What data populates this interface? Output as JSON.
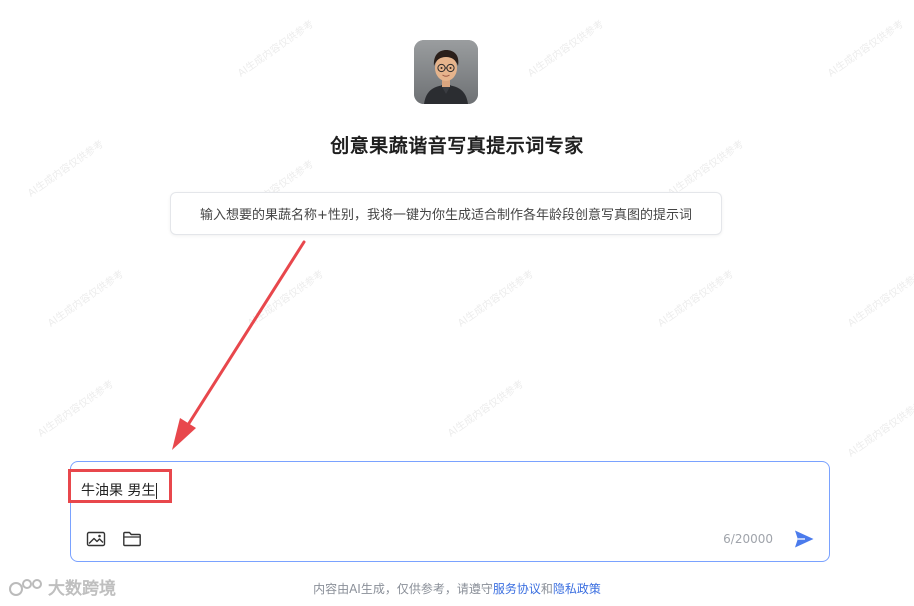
{
  "bot": {
    "title": "创意果蔬谐音写真提示词专家",
    "description": "输入想要的果蔬名称+性别，我将一键为你生成适合制作各年龄段创意写真图的提示词"
  },
  "chat": {
    "input_value": "牛油果 男生",
    "char_counter": "6/20000"
  },
  "footer": {
    "prefix": "内容由AI生成，仅供参考，请遵守",
    "service_link": "服务协议",
    "and": "和",
    "privacy_link": "隐私政策"
  },
  "watermark": {
    "brand": "大数跨境"
  },
  "icons": {
    "image_upload": "image-icon",
    "file_upload": "folder-icon",
    "send": "send-icon"
  },
  "colors": {
    "accent": "#3b6fe0",
    "annotation": "#e8474c",
    "chat_border": "#7aa2ff"
  }
}
